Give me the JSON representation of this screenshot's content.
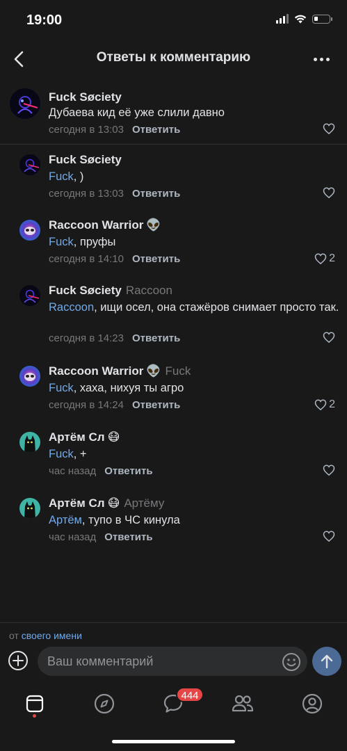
{
  "status_bar": {
    "time": "19:00",
    "battery_level": 0.25
  },
  "header": {
    "title": "Ответы к комментарию"
  },
  "parent_comment": {
    "author": "Fuck Søciety",
    "text": "Дубаева кид её уже слили давно",
    "time": "сегодня в 13:03",
    "reply_label": "Ответить"
  },
  "replies": [
    {
      "author": "Fuck Søciety",
      "emoji": "",
      "reply_to": "",
      "mention": "Fuck",
      "text": ", )",
      "time": "сегодня в 13:03",
      "reply_label": "Ответить",
      "likes": ""
    },
    {
      "author": "Raccoon Warrior",
      "emoji": "👽",
      "reply_to": "",
      "mention": "Fuck",
      "text": ", пруфы",
      "time": "сегодня в 14:10",
      "reply_label": "Ответить",
      "likes": "2"
    },
    {
      "author": "Fuck Søciety",
      "emoji": "",
      "reply_to": "Raccoon",
      "mention": "Raccoon",
      "text": ", ищи осел, она стажёров снимает просто так.",
      "time": "сегодня в 14:23",
      "reply_label": "Ответить",
      "likes": ""
    },
    {
      "author": "Raccoon Warrior",
      "emoji": "👽",
      "reply_to": "Fuck",
      "mention": "Fuck",
      "text": ", хаха, нихуя ты агро",
      "time": "сегодня в 14:24",
      "reply_label": "Ответить",
      "likes": "2"
    },
    {
      "author": "Артём Сл",
      "emoji": "😷",
      "reply_to": "",
      "mention": "Fuck",
      "text": ", +",
      "time": "час назад",
      "reply_label": "Ответить",
      "likes": ""
    },
    {
      "author": "Артём Сл",
      "emoji": "😷",
      "reply_to": "Артёму",
      "mention": "Артём",
      "text": ", тупо в ЧС кинула",
      "time": "час назад",
      "reply_label": "Ответить",
      "likes": ""
    }
  ],
  "compose": {
    "from_prefix": "от",
    "from_link": "своего имени",
    "placeholder": "Ваш комментарий"
  },
  "tabbar": {
    "messages_badge": "444"
  },
  "colors": {
    "background": "#19191a",
    "link": "#71aaeb",
    "secondary_text": "#76787a",
    "badge": "#e64646",
    "send_button": "#4b6a95"
  }
}
